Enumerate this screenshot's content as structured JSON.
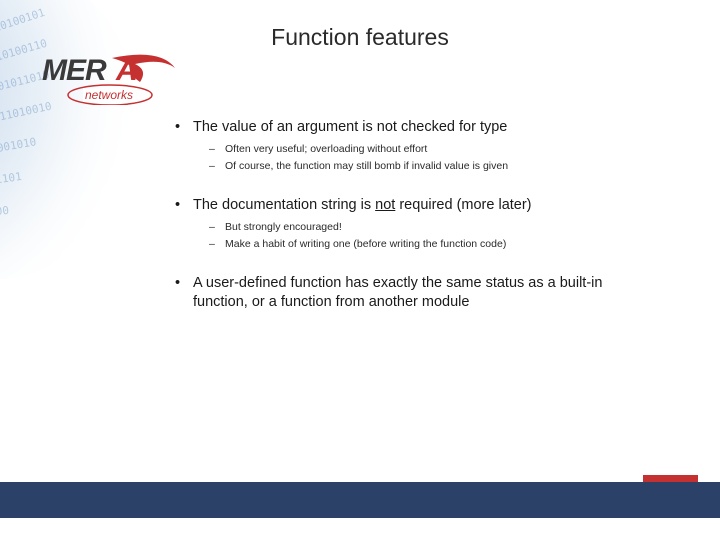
{
  "title": "Function features",
  "logo": {
    "main": "MERA",
    "sub": "networks"
  },
  "bullets": [
    {
      "text": "The value of an argument is not checked for type",
      "subs": [
        "Often very useful; overloading without effort",
        "Of course, the function may still bomb if invalid value is given"
      ]
    },
    {
      "text_before": "The documentation string is ",
      "text_underlined": "not",
      "text_after": " required (more later)",
      "subs": [
        "But strongly encouraged!",
        "Make a habit of writing one (before writing the function code)"
      ]
    },
    {
      "text": "A user-defined function has exactly the same status as a built-in function, or a function from another module",
      "subs": []
    }
  ]
}
